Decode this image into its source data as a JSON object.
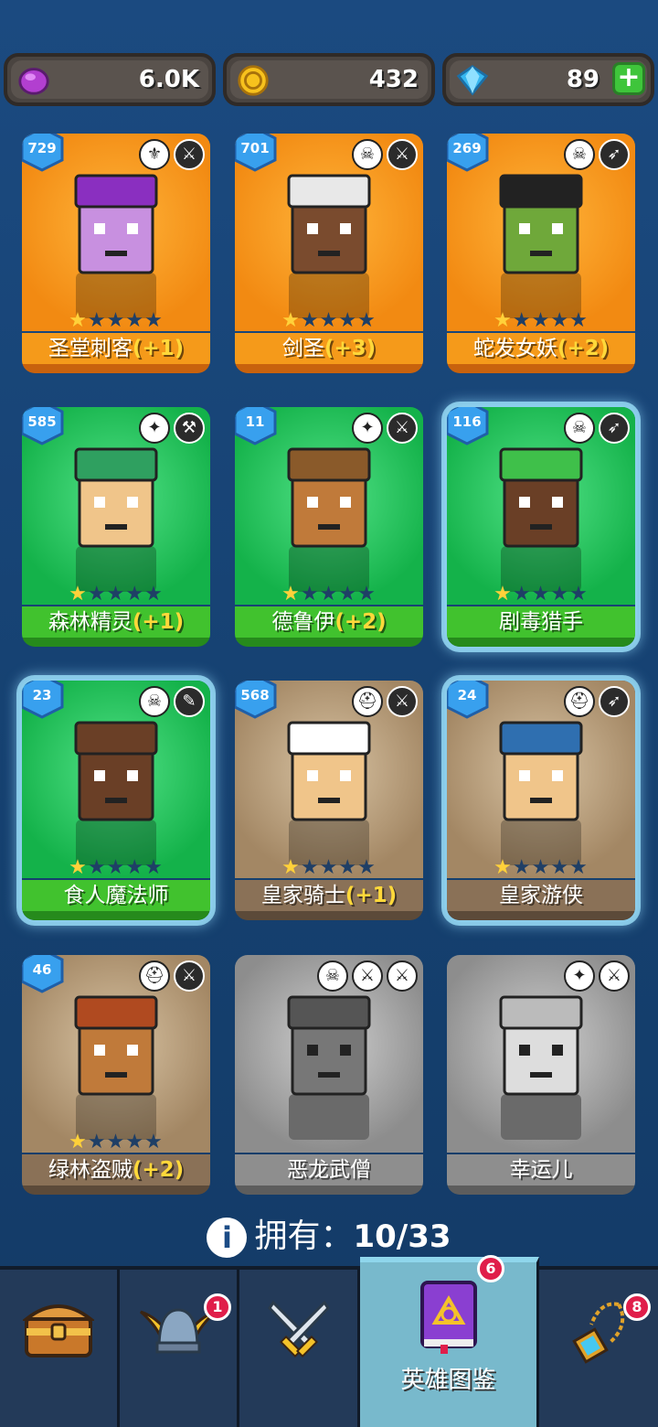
{
  "currency": {
    "gems_purple": "6.0K",
    "gold": "432",
    "diamonds": "89",
    "add_label": "+"
  },
  "heroes": [
    {
      "level": "729",
      "name": "圣堂刺客",
      "bonus": "(+1)",
      "stars": 1,
      "rarity": "orange"
    },
    {
      "level": "701",
      "name": "剑圣",
      "bonus": "(+3)",
      "stars": 1,
      "rarity": "orange"
    },
    {
      "level": "269",
      "name": "蛇发女妖",
      "bonus": "(+2)",
      "stars": 1,
      "rarity": "orange"
    },
    {
      "level": "585",
      "name": "森林精灵",
      "bonus": "(+1)",
      "stars": 1,
      "rarity": "green"
    },
    {
      "level": "11",
      "name": "德鲁伊",
      "bonus": "(+2)",
      "stars": 1,
      "rarity": "green"
    },
    {
      "level": "116",
      "name": "剧毒猎手",
      "bonus": "",
      "stars": 1,
      "rarity": "green"
    },
    {
      "level": "23",
      "name": "食人魔法师",
      "bonus": "",
      "stars": 1,
      "rarity": "green"
    },
    {
      "level": "568",
      "name": "皇家骑士",
      "bonus": "(+1)",
      "stars": 1,
      "rarity": "brown"
    },
    {
      "level": "24",
      "name": "皇家游侠",
      "bonus": "",
      "stars": 1,
      "rarity": "brown"
    },
    {
      "level": "46",
      "name": "绿林盗贼",
      "bonus": "(+2)",
      "stars": 1,
      "rarity": "brown"
    },
    {
      "level": "",
      "name": "恶龙武僧",
      "bonus": "",
      "stars": 0,
      "rarity": "gray"
    },
    {
      "level": "",
      "name": "幸运儿",
      "bonus": "",
      "stars": 0,
      "rarity": "gray"
    }
  ],
  "owned": {
    "label": "拥有：",
    "value": "10/33"
  },
  "nav": {
    "tabs": [
      {
        "icon": "treasure-chest-icon",
        "label": "",
        "badge": ""
      },
      {
        "icon": "winged-helmet-icon",
        "label": "",
        "badge": "1"
      },
      {
        "icon": "crossed-swords-icon",
        "label": "",
        "badge": ""
      },
      {
        "icon": "spellbook-icon",
        "label": "英雄图鉴",
        "badge": "6"
      },
      {
        "icon": "amulet-icon",
        "label": "",
        "badge": "8"
      }
    ]
  },
  "colors": {
    "orange": "#f59a1a",
    "green": "#41c22e",
    "brown": "#8a7157",
    "gray": "#8e8e8e",
    "background": "#164173"
  }
}
